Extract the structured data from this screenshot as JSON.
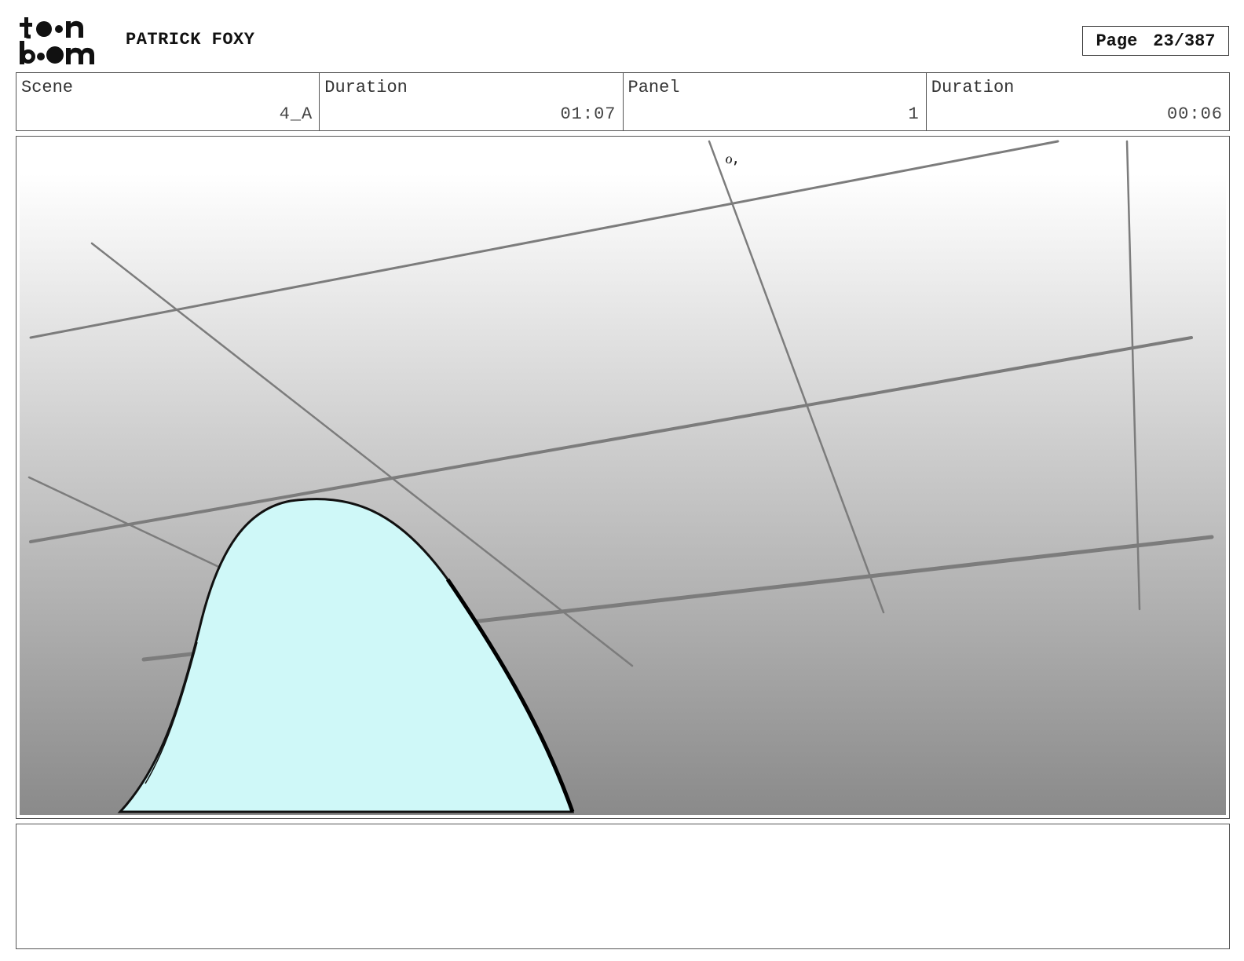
{
  "header": {
    "logo_text": "toon boom",
    "project_title": "PATRICK FOXY",
    "page_label": "Page",
    "page_number": "23/387"
  },
  "info": {
    "scene_label": "Scene",
    "scene_value": "4_A",
    "scene_duration_label": "Duration",
    "scene_duration_value": "01:07",
    "panel_label": "Panel",
    "panel_value": "1",
    "panel_duration_label": "Duration",
    "panel_duration_value": "00:06"
  },
  "panel": {
    "background_gradient": [
      "#ffffff",
      "#8a8a8a"
    ],
    "shape_fill": "#cff8f8",
    "line_color": "#7c7c7c"
  },
  "notes": {
    "text": ""
  }
}
